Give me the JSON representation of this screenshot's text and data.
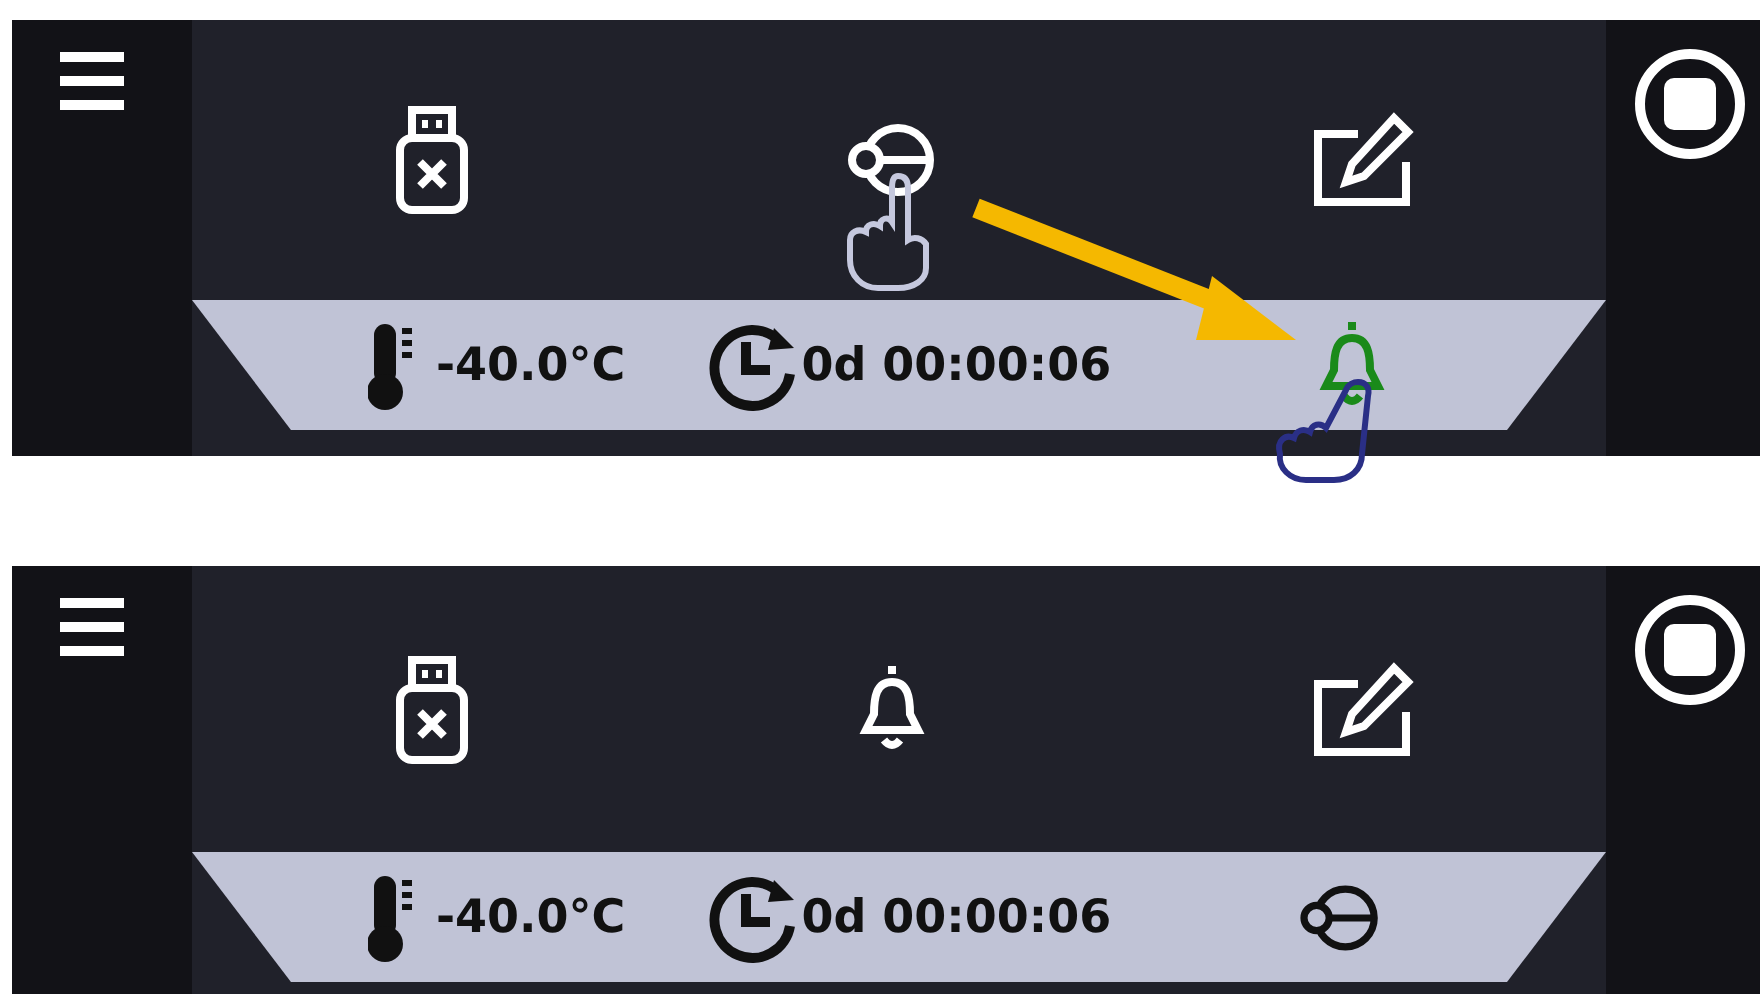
{
  "panels": [
    {
      "top_icons": [
        {
          "kind": "usb",
          "touched": false
        },
        {
          "kind": "key",
          "touched": true
        },
        {
          "kind": "edit",
          "touched": false
        }
      ],
      "temperature": "-40.0°C",
      "timer": "0d 00:00:06",
      "bar_icon": {
        "kind": "bell",
        "highlighted": true,
        "touched": true
      },
      "arrow": true
    },
    {
      "top_icons": [
        {
          "kind": "usb",
          "touched": false
        },
        {
          "kind": "bell",
          "touched": false
        },
        {
          "kind": "edit",
          "touched": false
        }
      ],
      "temperature": "-40.0°C",
      "timer": "0d 00:00:06",
      "bar_icon": {
        "kind": "key",
        "highlighted": false,
        "touched": false
      },
      "arrow": false
    }
  ]
}
